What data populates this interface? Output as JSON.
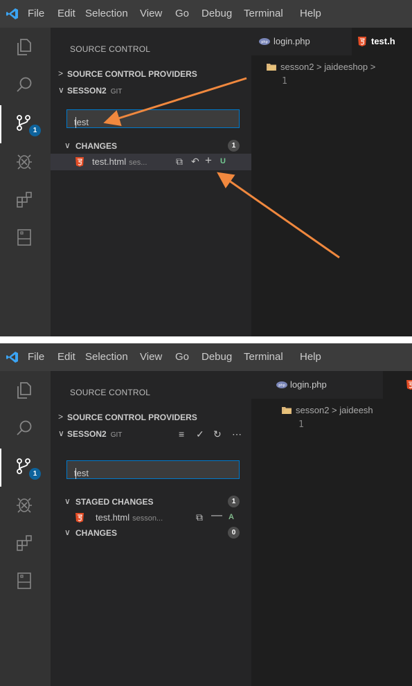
{
  "menu": [
    "File",
    "Edit",
    "Selection",
    "View",
    "Go",
    "Debug",
    "Terminal",
    "Help"
  ],
  "colors": {
    "accent": "#007acc",
    "badge": "#0e639c",
    "html_icon": "#e44d26",
    "untracked": "#73c991",
    "added": "#81b88b",
    "arrow": "#f0883e"
  },
  "activity_icons": [
    "explorer-icon",
    "search-icon",
    "source-control-icon",
    "debug-icon",
    "extensions-icon",
    "remote-icon"
  ],
  "badge": "1",
  "sidebar_title": "SOURCE CONTROL",
  "providers_label": "SOURCE CONTROL PROVIDERS",
  "repo_label": "SESSON2",
  "repo_tag": "GIT",
  "commit_message": "test",
  "tabs": {
    "login": "login.php",
    "test": "test.h"
  },
  "breadcrumb": "sesson2 > jaideeshop >",
  "breadcrumb2": "sesson2 > jaideesh",
  "line_number": "1",
  "shot1": {
    "changes_label": "CHANGES",
    "changes_count": "1",
    "file_name": "test.html",
    "file_path": "ses...",
    "file_status": "U"
  },
  "shot2": {
    "staged_label": "STAGED CHANGES",
    "staged_count": "1",
    "file_name": "test.html",
    "file_path": "sesson...",
    "file_status": "A",
    "changes_label": "CHANGES",
    "changes_count": "0"
  }
}
